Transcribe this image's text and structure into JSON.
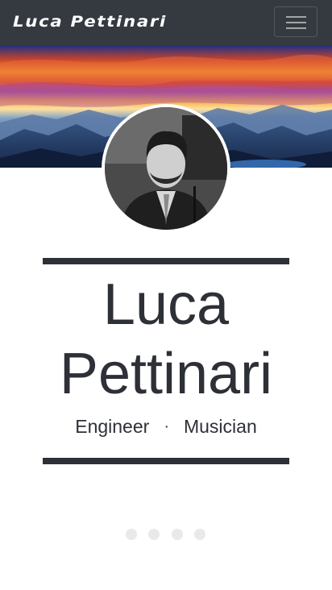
{
  "navbar": {
    "brand": "Luca Pettinari",
    "toggler_icon": "hamburger-menu-icon",
    "background": "#343a40"
  },
  "hero": {
    "image": "sunset-mountains-banner",
    "colors": [
      "#e2542a",
      "#f6b233",
      "#7a3a8a",
      "#2f4e7c"
    ]
  },
  "profile": {
    "avatar": "portrait-photo",
    "name_line_1": "Luca",
    "name_line_2": "Pettinari",
    "role_1": "Engineer",
    "separator": "·",
    "role_2": "Musician",
    "text_color": "#2d3036"
  },
  "pager": {
    "count": 4,
    "dot_color": "#e9e9e9"
  }
}
